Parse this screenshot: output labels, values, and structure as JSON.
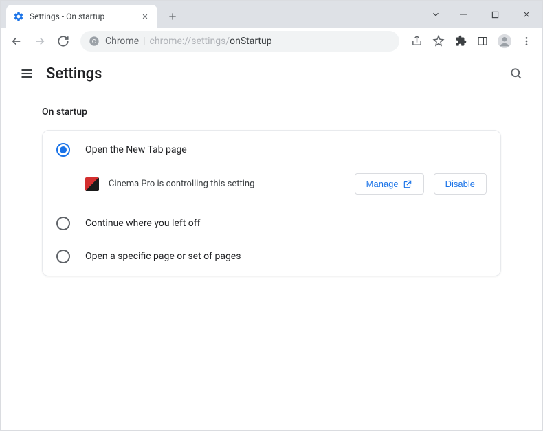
{
  "window": {
    "tab_title": "Settings - On startup"
  },
  "omnibox": {
    "host": "Chrome",
    "path_prefix": "chrome://settings/",
    "path_suffix": "onStartup"
  },
  "settings_header": {
    "title": "Settings"
  },
  "section": {
    "title": "On startup"
  },
  "startup_options": {
    "opt1": "Open the New Tab page",
    "opt2": "Continue where you left off",
    "opt3": "Open a specific page or set of pages"
  },
  "extension_notice": {
    "text": "Cinema Pro is controlling this setting",
    "manage_label": "Manage",
    "disable_label": "Disable"
  }
}
